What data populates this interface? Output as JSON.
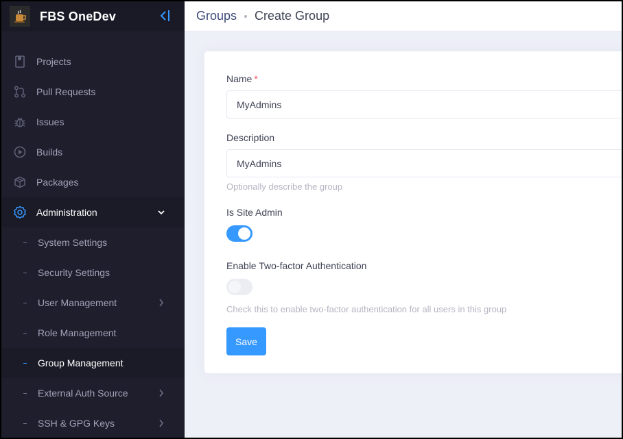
{
  "app": {
    "title": "FBS OneDev"
  },
  "sidebar": {
    "items": [
      {
        "label": "Projects",
        "icon": "book-icon"
      },
      {
        "label": "Pull Requests",
        "icon": "pull-request-icon"
      },
      {
        "label": "Issues",
        "icon": "bug-icon"
      },
      {
        "label": "Builds",
        "icon": "play-circle-icon"
      },
      {
        "label": "Packages",
        "icon": "package-icon"
      },
      {
        "label": "Administration",
        "icon": "gear-icon",
        "expanded": true
      }
    ],
    "admin_sub": [
      {
        "label": "System Settings"
      },
      {
        "label": "Security Settings"
      },
      {
        "label": "User Management",
        "has_children": true
      },
      {
        "label": "Role Management"
      },
      {
        "label": "Group Management",
        "selected": true
      },
      {
        "label": "External Auth Source",
        "has_children": true
      },
      {
        "label": "SSH & GPG Keys",
        "has_children": true
      }
    ]
  },
  "breadcrumb": {
    "parent": "Groups",
    "current": "Create Group"
  },
  "form": {
    "name_label": "Name",
    "required_mark": "*",
    "name_value": "MyAdmins",
    "description_label": "Description",
    "description_value": "MyAdmins",
    "description_help": "Optionally describe the group",
    "site_admin_label": "Is Site Admin",
    "site_admin_on": true,
    "twofa_label": "Enable Two-factor Authentication",
    "twofa_on": false,
    "twofa_help": "Check this to enable two-factor authentication for all users in this group",
    "save_label": "Save"
  },
  "colors": {
    "accent": "#3699ff",
    "sidebar_bg": "#1e1e2d",
    "required": "#f64e60"
  }
}
